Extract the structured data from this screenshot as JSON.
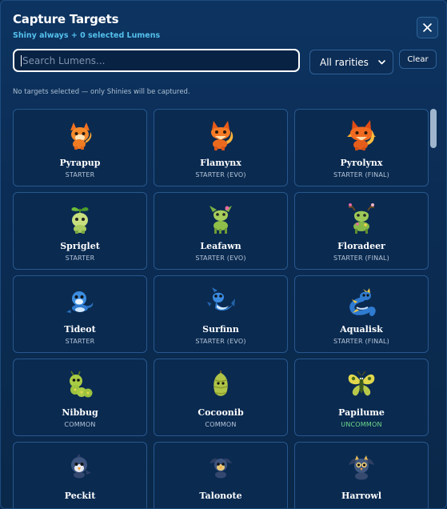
{
  "modal": {
    "title": "Capture Targets",
    "subtitle": "Shiny always + 0 selected Lumens",
    "close_icon": "close-icon"
  },
  "search": {
    "placeholder": "Search Lumens...",
    "value": ""
  },
  "rarity_filter": {
    "selected": "All rarities",
    "icon": "chevron-down-icon"
  },
  "clear_label": "Clear",
  "notice": "No targets selected — only Shinies will be captured.",
  "colors": {
    "accent": "#55c1ee",
    "uncommon": "#6fdc8c",
    "card_border": "#27588e"
  },
  "lumens": [
    {
      "name": "Pyrapup",
      "rarity": "STARTER",
      "icon": "fire-pup-icon"
    },
    {
      "name": "Flamynx",
      "rarity": "STARTER (EVO)",
      "icon": "fire-lynx-icon"
    },
    {
      "name": "Pyrolynx",
      "rarity": "STARTER (FINAL)",
      "icon": "fire-lynx-final-icon"
    },
    {
      "name": "Spriglet",
      "rarity": "STARTER",
      "icon": "sprout-icon"
    },
    {
      "name": "Leafawn",
      "rarity": "STARTER (EVO)",
      "icon": "leaf-fawn-icon"
    },
    {
      "name": "Floradeer",
      "rarity": "STARTER (FINAL)",
      "icon": "flower-deer-icon"
    },
    {
      "name": "Tideot",
      "rarity": "STARTER",
      "icon": "water-seal-icon"
    },
    {
      "name": "Surfinn",
      "rarity": "STARTER (EVO)",
      "icon": "water-fin-icon"
    },
    {
      "name": "Aqualisk",
      "rarity": "STARTER (FINAL)",
      "icon": "water-serpent-icon"
    },
    {
      "name": "Nibbug",
      "rarity": "COMMON",
      "icon": "caterpillar-icon"
    },
    {
      "name": "Cocoonib",
      "rarity": "COMMON",
      "icon": "cocoon-icon"
    },
    {
      "name": "Papilume",
      "rarity": "UNCOMMON",
      "icon": "butterfly-icon"
    },
    {
      "name": "Peckit",
      "rarity": "",
      "icon": "bird-chick-icon"
    },
    {
      "name": "Talonote",
      "rarity": "",
      "icon": "bird-icon"
    },
    {
      "name": "Harrowl",
      "rarity": "",
      "icon": "owl-icon"
    }
  ]
}
